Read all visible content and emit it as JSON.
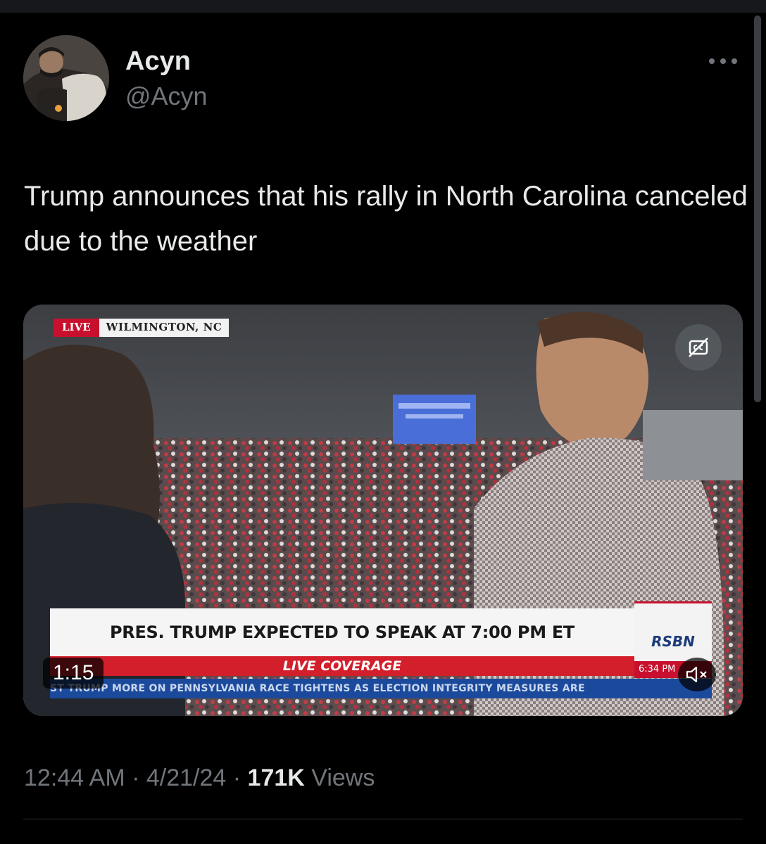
{
  "author": {
    "display_name": "Acyn",
    "handle": "@Acyn",
    "avatar_icon": "user-avatar"
  },
  "more_icon": "ellipsis-icon",
  "tweet": {
    "text": "Trump announces that his rally in North Carolina canceled due to the weather"
  },
  "video": {
    "live_label": "LIVE",
    "location": "WILMINGTON, NC",
    "headline": "PRES. TRUMP EXPECTED TO SPEAK AT 7:00 PM ET",
    "subline": "LIVE COVERAGE",
    "network": "RSBN",
    "network_time": "6:34 PM",
    "ticker": "ST TRUMP MORE ON    PENNSYLVANIA RACE TIGHTENS AS ELECTION INTEGRITY MEASURES ARE",
    "duration": "1:15",
    "cc_icon": "captions-off-icon",
    "mute_icon": "volume-muted-icon"
  },
  "meta": {
    "time": "12:44 AM",
    "separator": " · ",
    "date": "4/21/24",
    "views_count": "171K",
    "views_label": "Views"
  },
  "colors": {
    "background": "#000000",
    "text_primary": "#e7e9ea",
    "text_secondary": "#71767b",
    "live_red": "#c8102e",
    "ticker_blue": "#1b4a9c"
  }
}
